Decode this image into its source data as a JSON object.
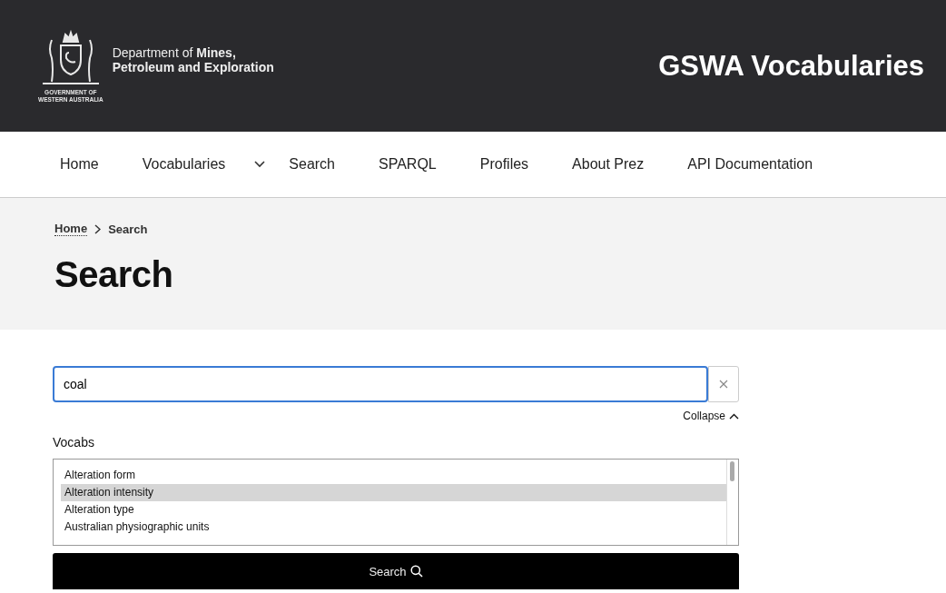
{
  "header": {
    "logo_caption": [
      "GOVERNMENT OF",
      "WESTERN AUSTRALIA"
    ],
    "department": "Department of **Mines,**",
    "department_line2": "Petroleum and Exploration",
    "site_title": "GSWA Vocabularies"
  },
  "nav": [
    {
      "label": "Home",
      "dropdown": false
    },
    {
      "label": "Vocabularies",
      "dropdown": true
    },
    {
      "label": "Search",
      "dropdown": false
    },
    {
      "label": "SPARQL",
      "dropdown": false
    },
    {
      "label": "Profiles",
      "dropdown": false
    },
    {
      "label": "About Prez",
      "dropdown": false
    },
    {
      "label": "API Documentation",
      "dropdown": false
    }
  ],
  "breadcrumbs": [
    "Home",
    "Search"
  ],
  "page_title": "Search",
  "search": {
    "value": "coal",
    "collapse_label": "Collapse",
    "vocabs_label": "Vocabs",
    "vocabs": [
      {
        "label": "Alteration form",
        "selected": false
      },
      {
        "label": "Alteration intensity",
        "selected": true
      },
      {
        "label": "Alteration type",
        "selected": false
      },
      {
        "label": "Australian physiographic units",
        "selected": false
      }
    ],
    "button": "Search"
  }
}
